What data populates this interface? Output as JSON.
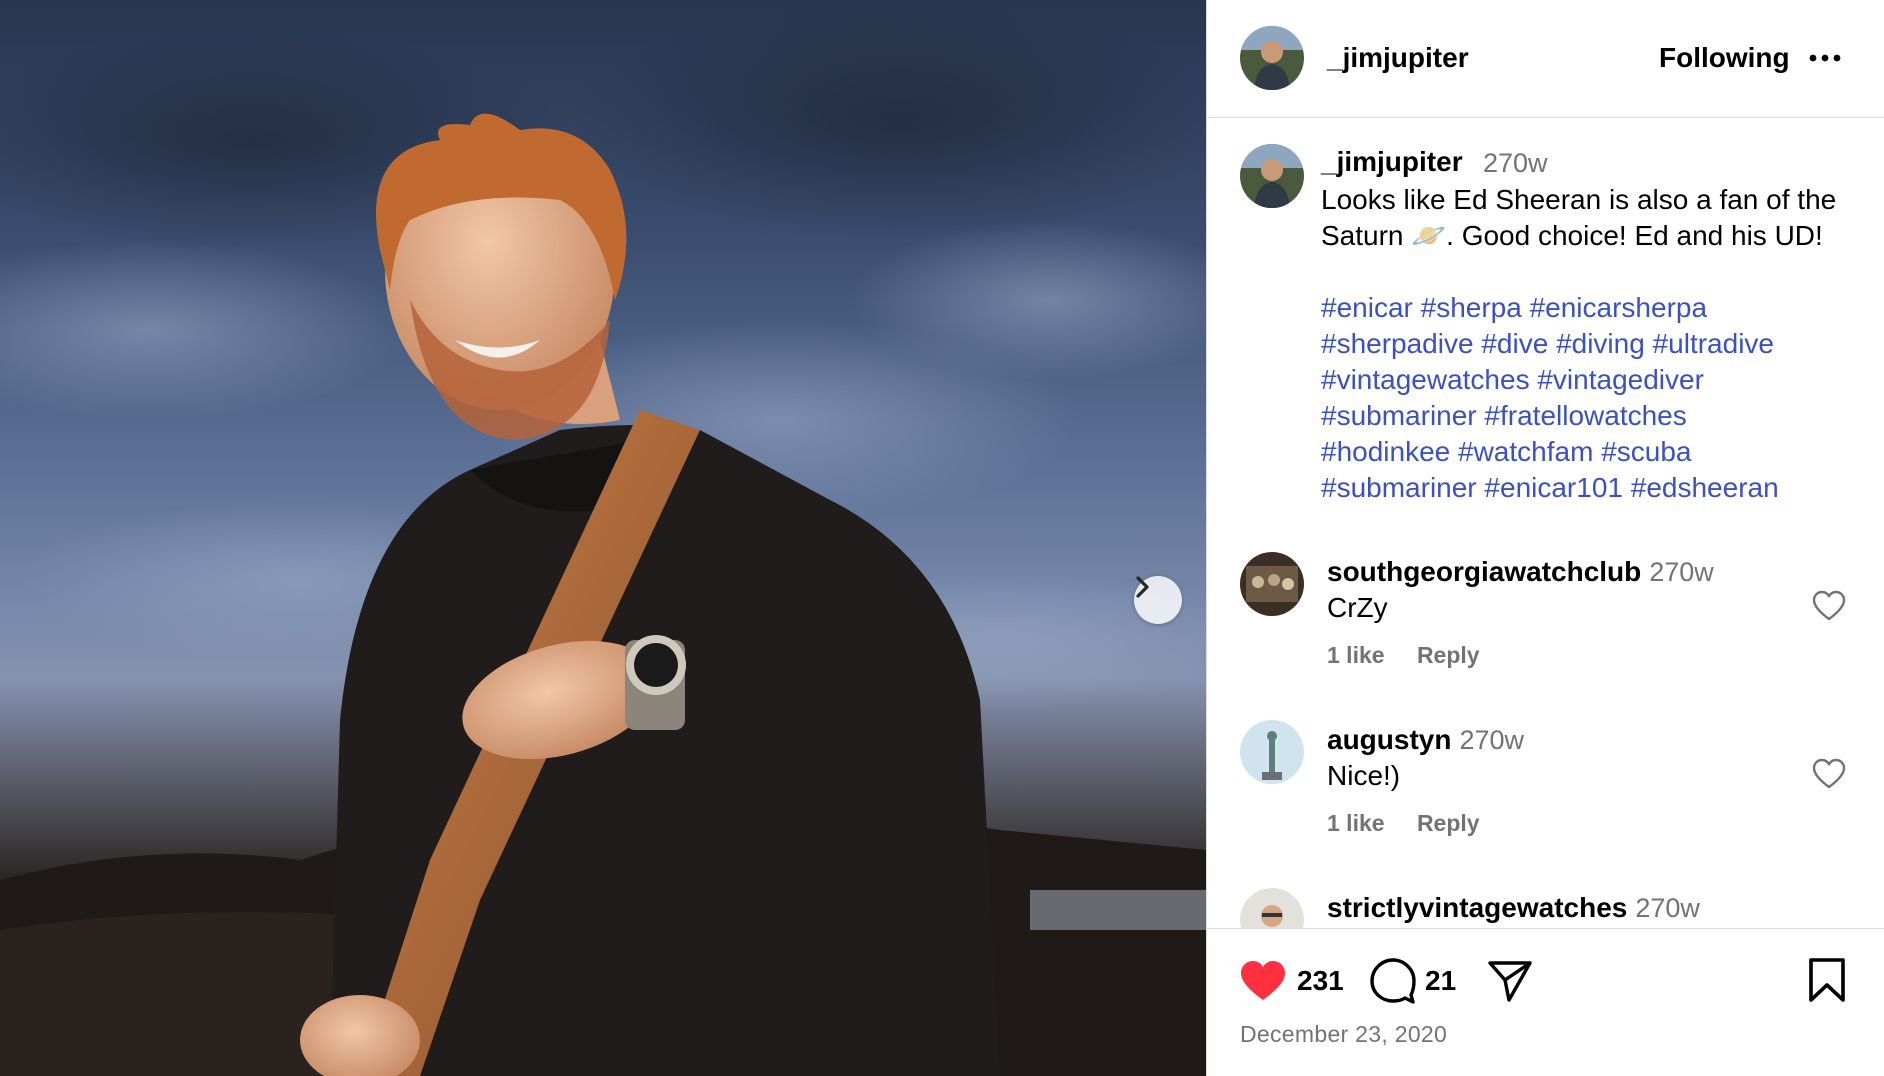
{
  "post": {
    "username": "_jimjupiter",
    "follow_label": "Following",
    "caption": {
      "username": "_jimjupiter",
      "time": "270w",
      "text": "Looks like Ed Sheeran is also a fan of the Saturn 🪐. Good choice! Ed and his UD!",
      "hashtags": [
        "#enicar",
        "#sherpa",
        "#enicarsherpa",
        "#sherpadive",
        "#dive",
        "#diving",
        "#ultradive",
        "#vintagewatches",
        "#vintagediver",
        "#submariner",
        "#fratellowatches",
        "#hodinkee",
        "#watchfam",
        "#scuba",
        "#submariner",
        "#enicar101",
        "#edsheeran"
      ]
    },
    "comments": [
      {
        "username": "southgeorgiawatchclub",
        "time": "270w",
        "text": "CrZy",
        "likes": "1 like",
        "reply": "Reply"
      },
      {
        "username": "augustyn",
        "time": "270w",
        "text": "Nice!)",
        "likes": "1 like",
        "reply": "Reply"
      },
      {
        "username": "strictlyvintagewatches",
        "time": "270w",
        "text": "",
        "likes": "",
        "reply": ""
      }
    ],
    "likes_count": "231",
    "comments_count": "21",
    "date": "December 23, 2020"
  },
  "icons": {
    "more": "more-horizontal-icon",
    "next": "chevron-right-icon",
    "like": "heart-filled-icon",
    "comment": "comment-bubble-icon",
    "share": "paper-plane-icon",
    "save": "bookmark-icon",
    "comment_like": "heart-outline-icon"
  },
  "colors": {
    "like_red": "#ff3040",
    "hashtag_blue": "#3a50c4",
    "secondary_text": "#737373"
  }
}
